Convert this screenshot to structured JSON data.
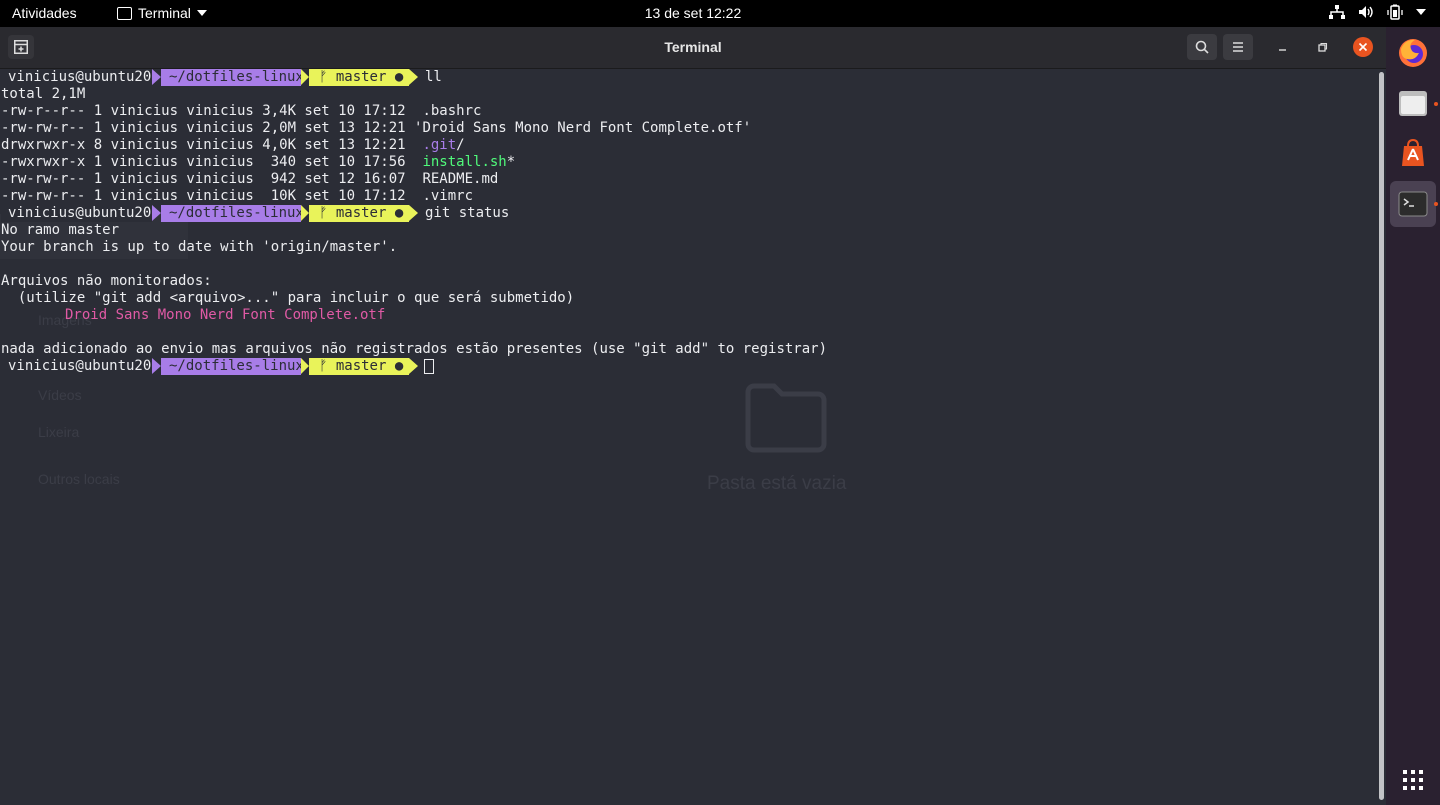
{
  "topbar": {
    "activities": "Atividades",
    "app_menu": "Terminal",
    "clock": "13 de set  12:22"
  },
  "window": {
    "title": "Terminal"
  },
  "prompt": {
    "user": "vinicius@ubuntu20",
    "dir": "~/dotfiles-linux",
    "branch": "master"
  },
  "terminal": {
    "cmd1": "ll",
    "total": "total 2,1M",
    "ls": [
      {
        "meta": "-rw-r--r-- 1 vinicius vinicius 3,4K set 10 17:12 ",
        "name": " .bashrc",
        "suffix": ""
      },
      {
        "meta": "-rw-rw-r-- 1 vinicius vinicius 2,0M set 13 12:21 ",
        "name": "'Droid Sans Mono Nerd Font Complete.otf'",
        "suffix": ""
      },
      {
        "meta": "drwxrwxr-x 8 vinicius vinicius 4,0K set 13 12:21 ",
        "name": " .git",
        "suffix": "/"
      },
      {
        "meta": "-rwxrwxr-x 1 vinicius vinicius  340 set 10 17:56 ",
        "name": " install.sh",
        "suffix": "*"
      },
      {
        "meta": "-rw-rw-r-- 1 vinicius vinicius  942 set 12 16:07 ",
        "name": " README.md",
        "suffix": ""
      },
      {
        "meta": "-rw-rw-r-- 1 vinicius vinicius  10K set 10 17:12 ",
        "name": " .vimrc",
        "suffix": ""
      }
    ],
    "cmd2": "git status",
    "status": [
      "No ramo master",
      "Your branch is up to date with 'origin/master'.",
      "",
      "Arquivos não monitorados:",
      "  (utilize \"git add <arquivo>...\" para incluir o que será submetido)"
    ],
    "untracked_file": "Droid Sans Mono Nerd Font Complete.otf",
    "nothing_added": "nada adicionado ao envio mas arquivos não registrados estão presentes (use \"git add\" to registrar)"
  },
  "background_ghost": {
    "sidebar_items": [
      "Imagens",
      "Vídeos",
      "Lixeira",
      "Outros locais"
    ],
    "empty_folder": "Pasta está vazia"
  },
  "colors": {
    "terminal_bg": "#2b2d36",
    "dir_segment": "#a87de8",
    "git_segment": "#e9f35a",
    "exec_file": "#50fa7b",
    "untracked": "#e05aa5",
    "ubuntu_orange": "#e95420"
  },
  "icons": {
    "network": "network-icon",
    "volume": "volume-icon",
    "battery": "battery-icon",
    "search": "search-icon",
    "menu": "hamburger-menu-icon"
  }
}
